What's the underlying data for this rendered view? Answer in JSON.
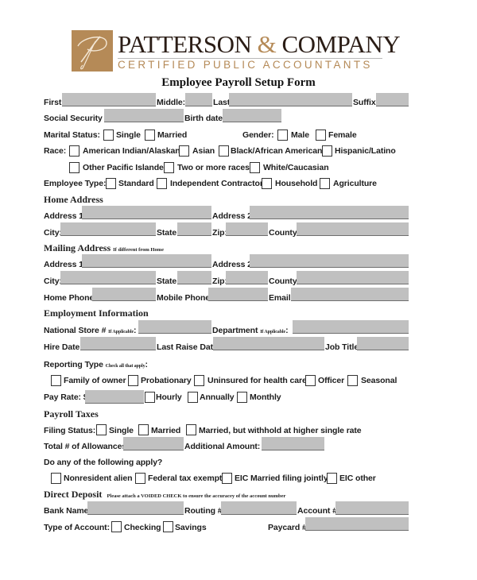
{
  "logo": {
    "company_name_part1": "PATTERSON",
    "company_name_amp": "&",
    "company_name_part2": "COMPANY",
    "tagline": "CERTIFIED PUBLIC ACCOUNTANTS",
    "brand_color": "#b58a57",
    "icon": "script-p-monogram-icon"
  },
  "form_title": "Employee Payroll Setup Form",
  "personal": {
    "first": "First:",
    "middle": "Middle:",
    "last": "Last:",
    "suffix": "Suffix:",
    "ssn": "Social Security #:",
    "birth_date": "Birth date:",
    "marital_status": "Marital Status:",
    "marital_options": [
      "Single",
      "Married"
    ],
    "gender": "Gender:",
    "gender_options": [
      "Male",
      "Female"
    ],
    "race": "Race:",
    "race_options": [
      "American Indian/Alaskan",
      "Asian",
      "Black/African American",
      "Hispanic/Latino",
      "Other Pacific Islander",
      "Two or more races",
      "White/Caucasian"
    ],
    "employee_type": "Employee Type:",
    "employee_type_options": [
      "Standard",
      "Independent Contractor",
      "Household",
      "Agriculture"
    ]
  },
  "home_address": {
    "heading": "Home Address",
    "address1": "Address 1:",
    "address2": "Address 2:",
    "city": "City:",
    "state": "State:",
    "zip": "Zip:",
    "county": "County:"
  },
  "mailing_address": {
    "heading": "Mailing Address",
    "note": "If different from Home",
    "address1": "Address 1:",
    "address2": "Address 2:",
    "city": "City:",
    "state": "State:",
    "zip": "Zip:",
    "county": "County:",
    "home_phone": "Home Phone:",
    "mobile_phone": "Mobile Phone:",
    "email": "Email:"
  },
  "employment": {
    "heading": "Employment Information",
    "national_store": "National Store #",
    "if_applicable": "If Applicable",
    "department": "Department",
    "hire_date": "Hire Date:",
    "last_raise_date": "Last Raise Date:",
    "job_title": "Job Title:",
    "reporting_type": "Reporting Type",
    "reporting_note": "Check all that apply",
    "reporting_options": [
      "Family of owner",
      "Probationary",
      "Uninsured for health care",
      "Officer",
      "Seasonal"
    ],
    "pay_rate": "Pay Rate: $",
    "pay_options": [
      "Hourly",
      "Annually",
      "Monthly"
    ]
  },
  "payroll_taxes": {
    "heading": "Payroll Taxes",
    "filing_status": "Filing Status:",
    "filing_options": [
      "Single",
      "Married",
      "Married, but withhold at higher single rate"
    ],
    "allowances": "Total # of Allowances:",
    "additional_amount": "Additional Amount: $",
    "apply_question": "Do any of the following apply?",
    "apply_options": [
      "Nonresident alien",
      "Federal tax exempt",
      "EIC Married filing jointly",
      "EIC other"
    ]
  },
  "direct_deposit": {
    "heading": "Direct Deposit",
    "note": "Please attach a VOIDED CHECK to ensure the accuracey of the account number",
    "bank_name": "Bank Name:",
    "routing": "Routing #:",
    "account": "Account #:",
    "type_of_account": "Type of Account:",
    "account_types": [
      "Checking",
      "Savings"
    ],
    "paycard": "Paycard #:"
  }
}
